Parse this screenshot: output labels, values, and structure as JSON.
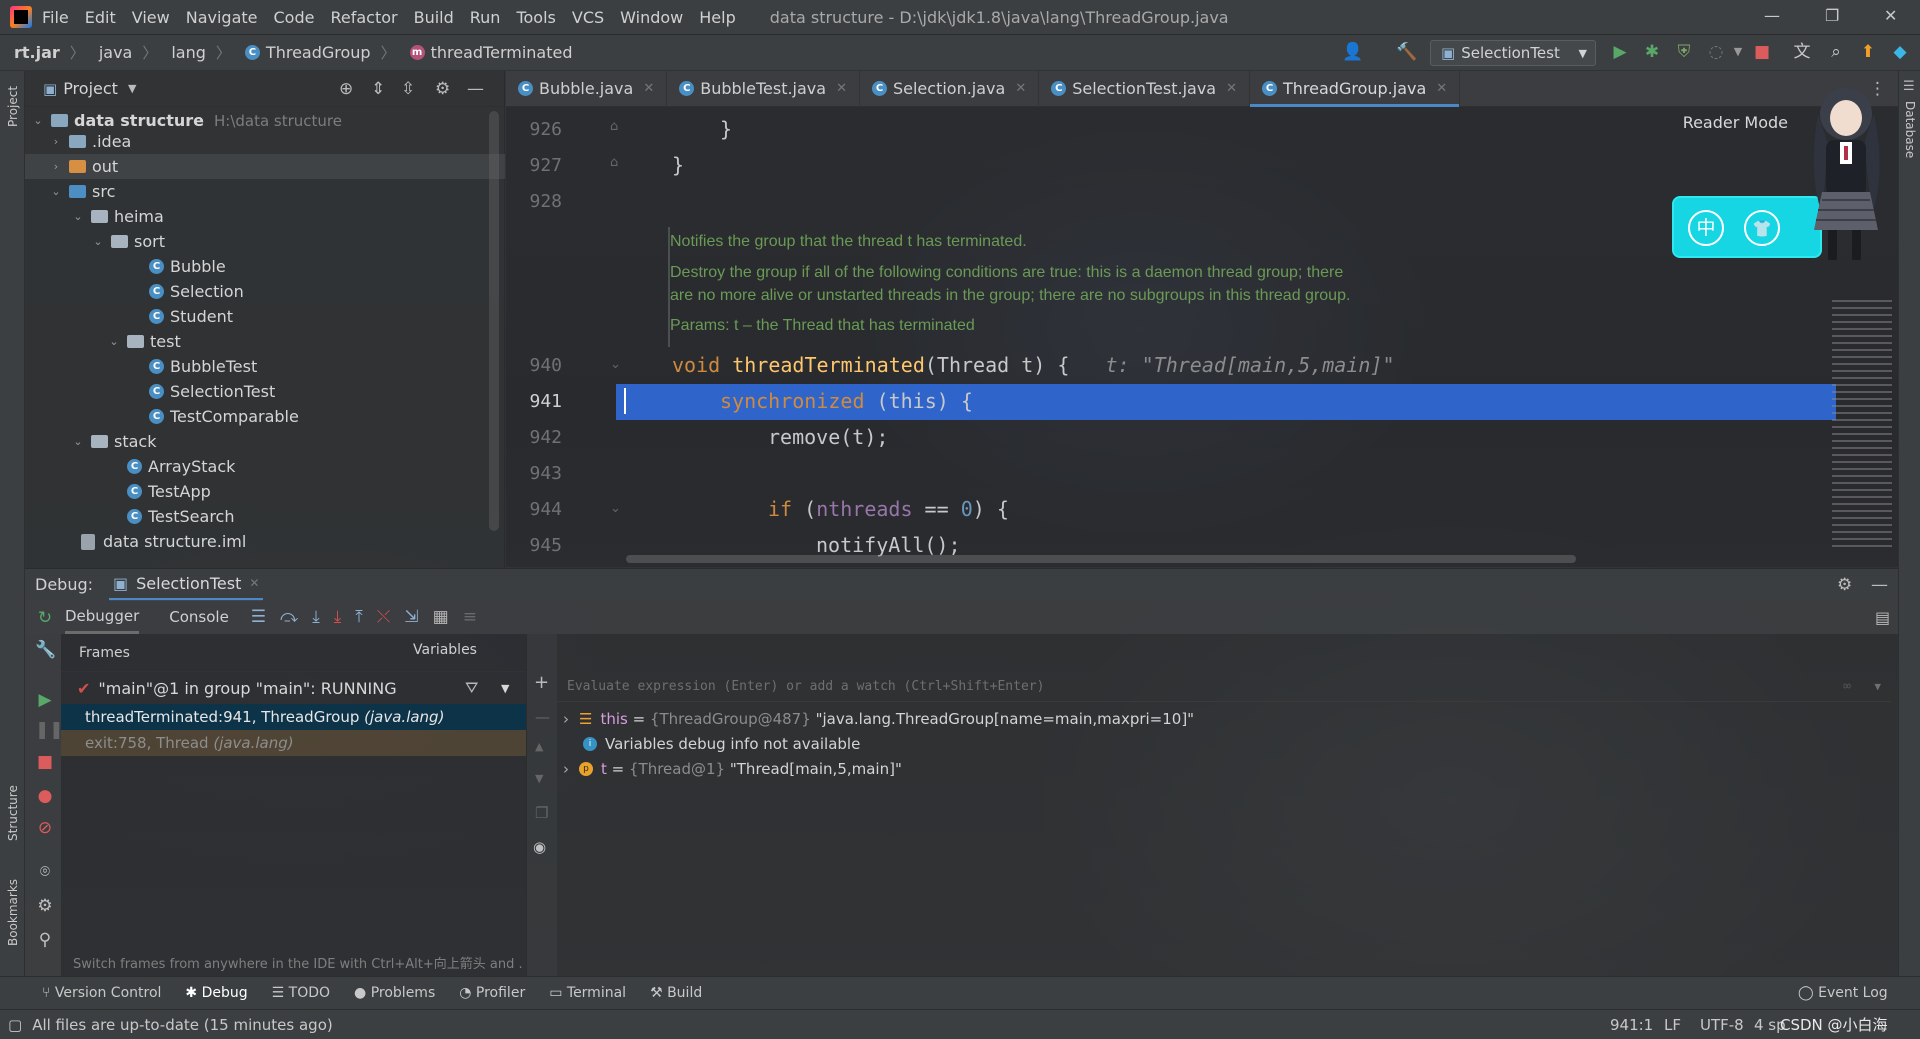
{
  "menu": [
    "File",
    "Edit",
    "View",
    "Navigate",
    "Code",
    "Refactor",
    "Build",
    "Run",
    "Tools",
    "VCS",
    "Window",
    "Help"
  ],
  "window_title": "data structure - D:\\jdk\\jdk1.8\\java\\lang\\ThreadGroup.java",
  "breadcrumbs": {
    "jar": "rt.jar",
    "p1": "java",
    "p2": "lang",
    "cls": "ThreadGroup",
    "method": "threadTerminated"
  },
  "run_config": "SelectionTest",
  "project": {
    "title": "Project",
    "tree": [
      {
        "label": "data structure",
        "extra": "H:\\data structure",
        "kind": "root"
      },
      {
        "label": ".idea",
        "kind": "folder"
      },
      {
        "label": "out",
        "kind": "folder-orange"
      },
      {
        "label": "src",
        "kind": "folder-blue"
      },
      {
        "label": "heima",
        "kind": "package"
      },
      {
        "label": "sort",
        "kind": "package"
      },
      {
        "label": "Bubble",
        "kind": "class"
      },
      {
        "label": "Selection",
        "kind": "class"
      },
      {
        "label": "Student",
        "kind": "class"
      },
      {
        "label": "test",
        "kind": "package"
      },
      {
        "label": "BubbleTest",
        "kind": "class"
      },
      {
        "label": "SelectionTest",
        "kind": "class"
      },
      {
        "label": "TestComparable",
        "kind": "class"
      },
      {
        "label": "stack",
        "kind": "package"
      },
      {
        "label": "ArrayStack",
        "kind": "class"
      },
      {
        "label": "TestApp",
        "kind": "class"
      },
      {
        "label": "TestSearch",
        "kind": "class"
      },
      {
        "label": "data structure.iml",
        "kind": "file"
      }
    ]
  },
  "tabs": [
    {
      "label": "Bubble.java"
    },
    {
      "label": "BubbleTest.java"
    },
    {
      "label": "Selection.java"
    },
    {
      "label": "SelectionTest.java"
    },
    {
      "label": "ThreadGroup.java",
      "active": true
    }
  ],
  "editor": {
    "reader_mode": "Reader Mode",
    "lines": {
      "l926": "926",
      "l927": "927",
      "l928": "928",
      "l940": "940",
      "l941": "941",
      "l942": "942",
      "l943": "943",
      "l944": "944",
      "l945": "945"
    },
    "brace": "}",
    "doc": {
      "p1": "Notifies the group that the thread t has terminated.",
      "p2": "Destroy the group if all of the following conditions are true: this is a daemon thread group; there",
      "p3": "are no more alive or unstarted threads in the group; there are no subgroups in this thread group.",
      "p4": "Params: t – the Thread that has terminated"
    },
    "code": {
      "void": "void",
      "method": "threadTerminated",
      "params": "(Thread t) {",
      "hint": "t: \"Thread[main,5,main]\"",
      "sync": "synchronized",
      "sync_rest": " (this) {",
      "remove": "remove(t);",
      "if": "if",
      "if_open": " (",
      "nthreads": "nthreads",
      "eq": " == ",
      "zero": "0",
      "if_close": ") {",
      "notify": "notifyAll();"
    }
  },
  "widget": {
    "zh": "中",
    "shirt": "👕"
  },
  "debug": {
    "label": "Debug:",
    "session": "SelectionTest",
    "debugger_tab": "Debugger",
    "console_tab": "Console",
    "frames_title": "Frames",
    "thread": "\"main\"@1 in group \"main\": RUNNING",
    "frames": [
      {
        "method": "threadTerminated:941, ThreadGroup",
        "pkg": "(java.lang)"
      },
      {
        "method": "exit:758, Thread",
        "pkg": "(java.lang)"
      }
    ],
    "tip": "Switch frames from anywhere in the IDE with Ctrl+Alt+向上箭头 and .",
    "variables_title": "Variables",
    "eval_placeholder": "Evaluate expression (Enter) or add a watch (Ctrl+Shift+Enter)",
    "vars": [
      {
        "name": "this",
        "type": "{ThreadGroup@487}",
        "value": "\"java.lang.ThreadGroup[name=main,maxpri=10]\""
      },
      {
        "info": "Variables debug info not available"
      },
      {
        "name": "t",
        "type": "{Thread@1}",
        "value": "\"Thread[main,5,main]\""
      }
    ]
  },
  "bottom_tools": [
    "Version Control",
    "Debug",
    "TODO",
    "Problems",
    "Profiler",
    "Terminal",
    "Build"
  ],
  "event_log": "Event Log",
  "status": {
    "message": "All files are up-to-date (15 minutes ago)",
    "position": "941:1",
    "line_sep": "LF",
    "encoding": "UTF-8",
    "indent": "4 sp",
    "watermark": "CSDN @小白海"
  },
  "colors": {
    "accent": "#4a88c7",
    "exec_line": "#2f65ca",
    "keyword": "#d08a3e",
    "method": "#ffc66d",
    "number": "#6897bb",
    "field": "#9876aa",
    "doc": "#6a9a55",
    "widget": "#16d6e3"
  }
}
